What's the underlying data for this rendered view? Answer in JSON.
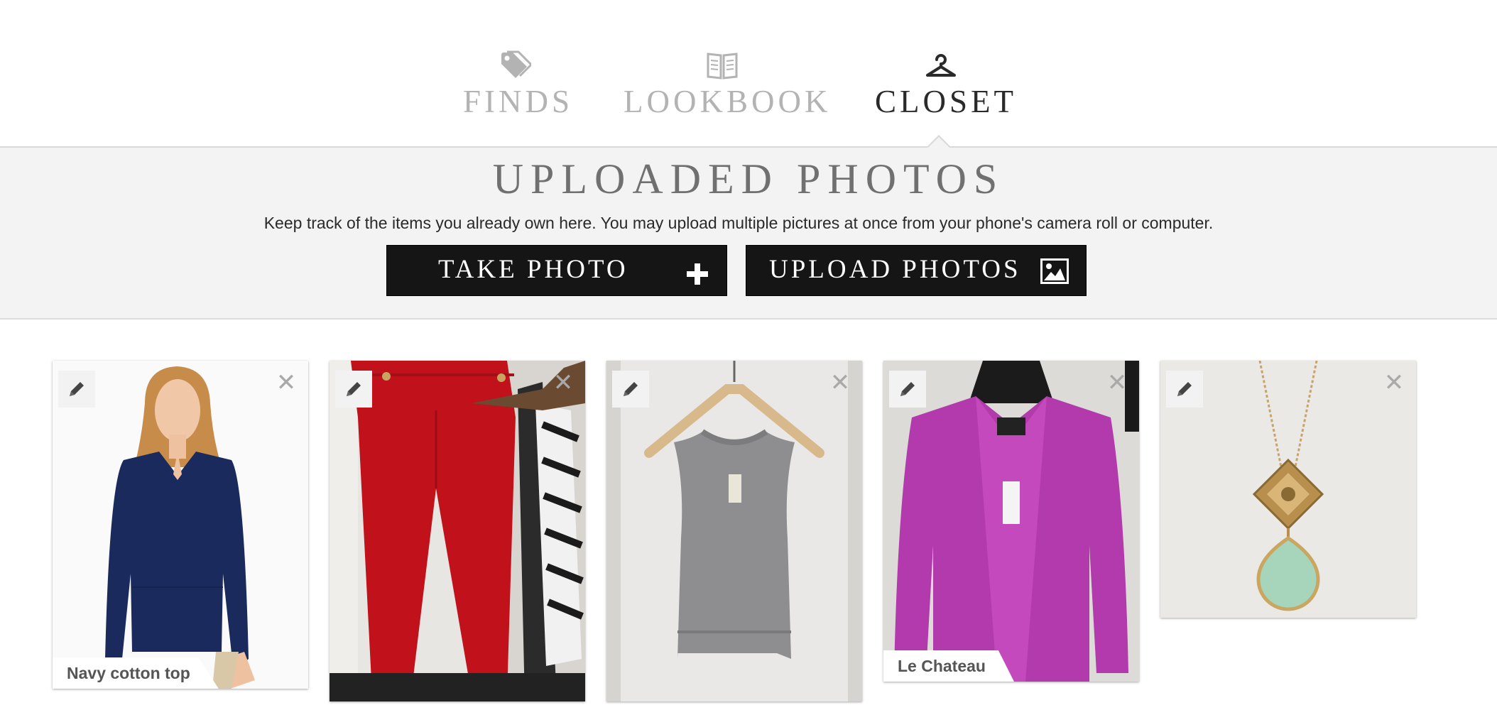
{
  "nav": {
    "tabs": [
      {
        "label": "FINDS",
        "icon": "tag-icon",
        "active": false
      },
      {
        "label": "LOOKBOOK",
        "icon": "book-icon",
        "active": false
      },
      {
        "label": "CLOSET",
        "icon": "hanger-icon",
        "active": true
      }
    ]
  },
  "header": {
    "title": "UPLOADED PHOTOS",
    "description": "Keep track of the items you already own here. You may upload multiple pictures at once from your phone's camera roll or computer.",
    "take_photo_label": "TAKE PHOTO",
    "take_photo_icon": "plus-icon",
    "upload_photos_label": "UPLOAD PHOTOS",
    "upload_photos_icon": "image-icon"
  },
  "closet": {
    "items": [
      {
        "label": "Navy cotton top",
        "photo": "navy top on model"
      },
      {
        "label": "",
        "photo": "red pants"
      },
      {
        "label": "",
        "photo": "grey sleeveless knit top"
      },
      {
        "label": "Le Chateau",
        "photo": "magenta cardigan"
      },
      {
        "label": "",
        "photo": "gold pendant with mint stone"
      }
    ]
  },
  "colors": {
    "accent_dark": "#151515",
    "band_bg": "#f3f3f3",
    "inactive_tab": "#b3b3b3"
  }
}
